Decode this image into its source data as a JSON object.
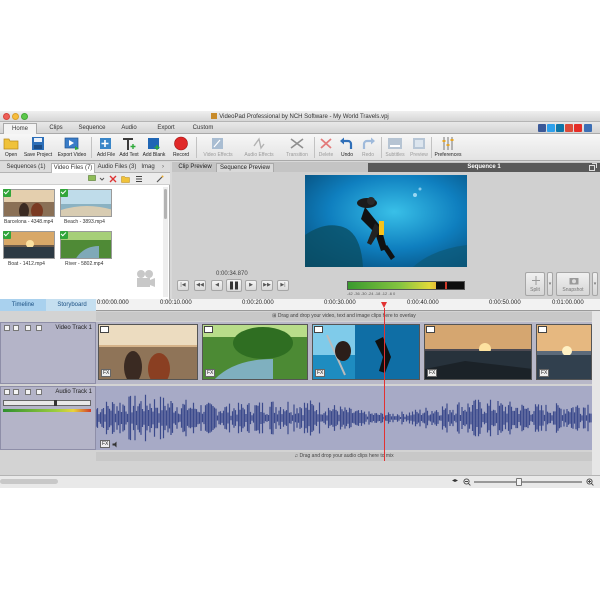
{
  "window": {
    "title": "VideoPad Professional by NCH Software - My World Travels.vpj"
  },
  "menu": {
    "tabs": [
      "Home",
      "Clips",
      "Sequence",
      "Audio",
      "Export",
      "Custom"
    ],
    "active": "Home"
  },
  "toolbar": {
    "open": "Open",
    "save_project": "Save Project",
    "export_video": "Export Video",
    "add_file": "Add File",
    "add_text": "Add Text",
    "add_blank": "Add Blank",
    "record": "Record",
    "video_effects": "Video Effects",
    "audio_effects": "Audio Effects",
    "transition": "Transition",
    "delete": "Delete",
    "undo": "Undo",
    "redo": "Redo",
    "subtitles": "Subtitles",
    "preview": "Preview",
    "preferences": "Preferences"
  },
  "bins": {
    "tabs": [
      "Sequences (1)",
      "Video Files (7)",
      "Audio Files (3)",
      "Imag"
    ],
    "active_tab": "Video Files (7)",
    "items": [
      {
        "label": "Barcelona - 4348.mp4"
      },
      {
        "label": "Beach - 3893.mp4"
      },
      {
        "label": "Boat - 1412.mp4"
      },
      {
        "label": "River - 5802.mp4"
      }
    ]
  },
  "preview": {
    "tabs": [
      "Clip Preview",
      "Sequence Preview"
    ],
    "active_tab": "Sequence Preview",
    "sequence_title": "Sequence 1",
    "timecode": "0:00:34.870",
    "meter_scale": "-42  -36  -30  -24  -18  -12   -6    0",
    "split_label": "Split",
    "snapshot_label": "Snapshot"
  },
  "timeline": {
    "tabs": [
      "Timeline",
      "Storyboard"
    ],
    "active_tab": "Timeline",
    "ruler": [
      "0:00:00.000",
      "0:00:10.000",
      "0:00:20.000",
      "0:00:30.000",
      "0:00:40.000",
      "0:00:50.000",
      "0:01:00.000"
    ],
    "video_hint": "Drag and drop your video, text and image clips here to overlay",
    "video_track": "Video Track 1",
    "audio_track": "Audio Track 1",
    "audio_hint": "Drag and drop your audio clips here to mix",
    "fx_label": "FX"
  },
  "colors": {
    "accent": "#3a86c8",
    "playhead": "#e23232",
    "waveform": "#3b4a8c",
    "record": "#e02828"
  }
}
